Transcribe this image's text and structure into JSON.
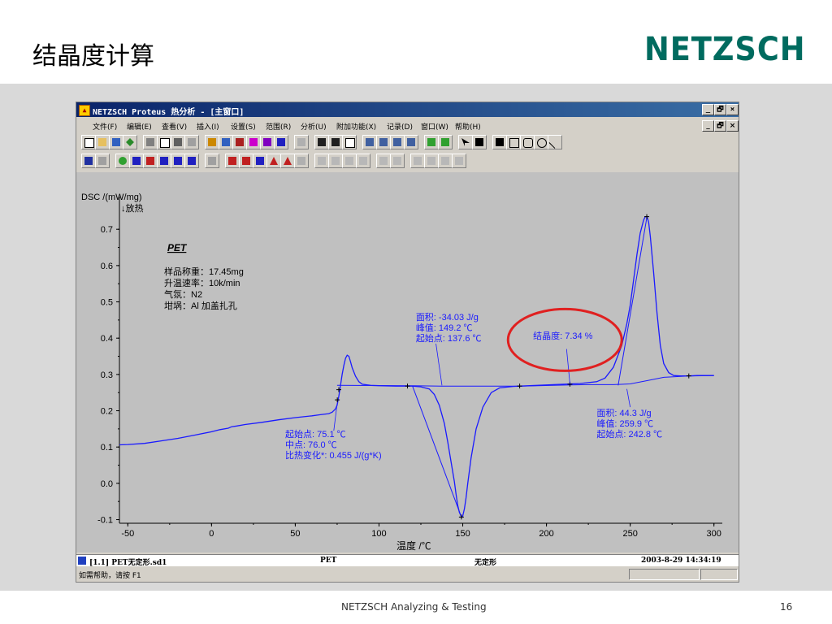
{
  "slide": {
    "title": "结晶度计算",
    "logo": "NETZSCH",
    "footer_center": "NETZSCH Analyzing & Testing",
    "page_number": "16"
  },
  "window": {
    "title": "NETZSCH Proteus 热分析 - [主窗口]",
    "min_label": "_",
    "restore_label": "🗗",
    "close_label": "×",
    "menu": [
      "文件(F)",
      "编辑(E)",
      "查看(V)",
      "插入(I)",
      "设置(S)",
      "范围(R)",
      "分析(U)",
      "附加功能(X)",
      "记录(D)",
      "窗口(W)",
      "帮助(H)"
    ],
    "status": {
      "file": "[1.1] PET无定形.sd1",
      "sample": "PET",
      "state": "无定形",
      "datetime": "2003-8-29 14:34:19"
    },
    "help_text": "如需帮助，请按 F1"
  },
  "chart_data": {
    "type": "line",
    "ylabel": "DSC /(mW/mg)",
    "ylabel_note": "↓放热",
    "xlabel": "温度 /℃",
    "xlim": [
      -55,
      305
    ],
    "ylim": [
      -0.11,
      0.79
    ],
    "xticks": [
      -50,
      0,
      50,
      100,
      150,
      200,
      250,
      300
    ],
    "yticks": [
      -0.1,
      0.0,
      0.1,
      0.2,
      0.3,
      0.4,
      0.5,
      0.6,
      0.7
    ],
    "ytick_labels": [
      "-0.1",
      "0.0",
      "0.1",
      "0.2",
      "0.3",
      "0.4",
      "0.5",
      "0.6",
      "0.7"
    ],
    "line_color": "#1a1aff",
    "sample_info": {
      "name": "PET",
      "lines": [
        "样品称重：17.45mg",
        "升温速率：10k/min",
        "气氛：N2",
        "坩埚：Al 加盖扎孔"
      ]
    },
    "series": [
      {
        "x": [
          -55,
          -50,
          -40,
          -30,
          -20,
          -10,
          0,
          5,
          10,
          12,
          15,
          20,
          30,
          40,
          50,
          60,
          65,
          70,
          72,
          74,
          75,
          76,
          77,
          78,
          79,
          80,
          81,
          82,
          83,
          84,
          86,
          88,
          90,
          95,
          100,
          110,
          120,
          125,
          130,
          133,
          136,
          139,
          141,
          143,
          145,
          146,
          147,
          148,
          149,
          149.5,
          150,
          151,
          152,
          153,
          155,
          158,
          162,
          167,
          172,
          180,
          190,
          200,
          210,
          220,
          230,
          235,
          240,
          245,
          248,
          250,
          252,
          254,
          256,
          258,
          259,
          260,
          261,
          262,
          264,
          266,
          268,
          270,
          273,
          276,
          280,
          285,
          290,
          300
        ],
        "y": [
          0.106,
          0.107,
          0.11,
          0.117,
          0.124,
          0.133,
          0.142,
          0.148,
          0.152,
          0.156,
          0.158,
          0.162,
          0.168,
          0.175,
          0.181,
          0.186,
          0.189,
          0.192,
          0.196,
          0.205,
          0.215,
          0.24,
          0.27,
          0.3,
          0.325,
          0.345,
          0.353,
          0.35,
          0.335,
          0.318,
          0.295,
          0.28,
          0.273,
          0.27,
          0.269,
          0.268,
          0.268,
          0.266,
          0.26,
          0.245,
          0.215,
          0.165,
          0.115,
          0.06,
          0.005,
          -0.03,
          -0.06,
          -0.08,
          -0.09,
          -0.093,
          -0.09,
          -0.07,
          -0.04,
          0.0,
          0.07,
          0.15,
          0.21,
          0.25,
          0.263,
          0.267,
          0.269,
          0.271,
          0.273,
          0.275,
          0.28,
          0.29,
          0.32,
          0.38,
          0.44,
          0.49,
          0.56,
          0.63,
          0.69,
          0.725,
          0.735,
          0.735,
          0.72,
          0.68,
          0.58,
          0.47,
          0.38,
          0.33,
          0.305,
          0.297,
          0.296,
          0.296,
          0.297,
          0.297
        ]
      }
    ],
    "baselines": [
      {
        "x": [
          75,
          120,
          137.6,
          185,
          214,
          225,
          240,
          250,
          260,
          270,
          285,
          300
        ],
        "y": [
          0.27,
          0.269,
          0.268,
          0.268,
          0.271,
          0.272,
          0.272,
          0.274,
          0.283,
          0.292,
          0.296,
          0.297
        ]
      },
      {
        "x": [
          242.8,
          260
        ],
        "y": [
          0.27,
          0.735
        ]
      },
      {
        "x": [
          120,
          149.2
        ],
        "y": [
          0.268,
          -0.093
        ]
      }
    ],
    "markers": [
      {
        "x": 75.1,
        "y": 0.23
      },
      {
        "x": 76.0,
        "y": 0.258
      },
      {
        "x": 117,
        "y": 0.268
      },
      {
        "x": 184,
        "y": 0.268
      },
      {
        "x": 214,
        "y": 0.273
      },
      {
        "x": 149.2,
        "y": -0.093
      },
      {
        "x": 259.9,
        "y": 0.735
      },
      {
        "x": 285,
        "y": 0.296
      }
    ],
    "annotations": [
      {
        "id": "cold",
        "lines": [
          "面积:       -34.03 J/g",
          "峰值:      149.2 ℃",
          "起始点:  137.6 ℃"
        ],
        "x": 122,
        "y": 0.45
      },
      {
        "id": "crys",
        "lines": [
          "结晶度: 7.34 %"
        ],
        "x": 192,
        "y": 0.398
      },
      {
        "id": "melt",
        "lines": [
          "面积:          44.3 J/g",
          "峰值:       259.9 ℃",
          "起始点:  242.8 ℃"
        ],
        "x": 230,
        "y": 0.185
      },
      {
        "id": "glass",
        "lines": [
          "起始点:       75.1 ℃",
          "中点:           76.0 ℃",
          "比热变化*:    0.455 J/(g*K)"
        ],
        "x": 44,
        "y": 0.127
      }
    ],
    "highlight_color": "#e02020"
  }
}
